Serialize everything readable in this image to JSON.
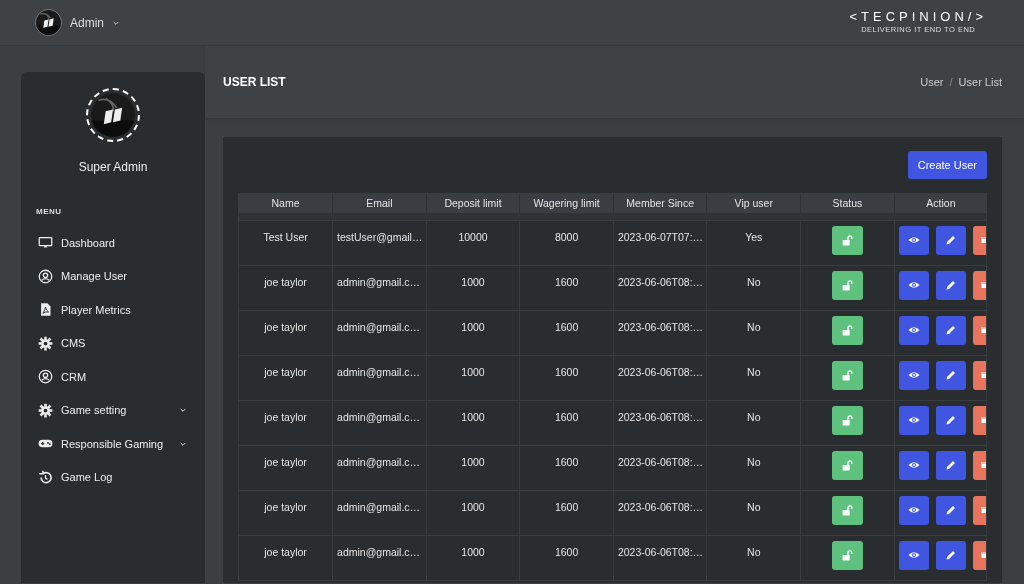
{
  "topbar": {
    "user": "Admin",
    "logo": {
      "title": "<TECPINION/>",
      "tagline": "DELIVERING IT END TO END"
    }
  },
  "sidebar": {
    "profile_name": "Super Admin",
    "menu_heading": "MENU",
    "items": [
      {
        "label": "Dashboard",
        "kind": "monitor",
        "expandable": false
      },
      {
        "label": "Manage User",
        "kind": "user",
        "expandable": false
      },
      {
        "label": "Player Metrics",
        "kind": "pdf",
        "expandable": false
      },
      {
        "label": "CMS",
        "kind": "gear",
        "expandable": false
      },
      {
        "label": "CRM",
        "kind": "user",
        "expandable": false
      },
      {
        "label": "Game setting",
        "kind": "gear",
        "expandable": true
      },
      {
        "label": "Responsible Gaming",
        "kind": "gamepad",
        "expandable": true
      },
      {
        "label": "Game Log",
        "kind": "history",
        "expandable": false
      }
    ]
  },
  "page": {
    "title": "USER LIST",
    "breadcrumb": [
      "User",
      "User List"
    ],
    "breadcrumb_separator": "/",
    "create_button": "Create User"
  },
  "table": {
    "columns": [
      "Name",
      "Email",
      "Deposit limit",
      "Wagering limit",
      "Member Since",
      "Vip user",
      "Status",
      "Action"
    ],
    "rows": [
      {
        "name": "Test User",
        "email": "testUser@gmail…",
        "deposit": "10000",
        "wagering": "8000",
        "member_since": "2023-06-07T07:…",
        "vip": "Yes",
        "locked": false
      },
      {
        "name": "joe taylor",
        "email": "admin@gmail.c…",
        "deposit": "1000",
        "wagering": "1600",
        "member_since": "2023-06-06T08:…",
        "vip": "No",
        "locked": false
      },
      {
        "name": "joe taylor",
        "email": "admin@gmail.c…",
        "deposit": "1000",
        "wagering": "1600",
        "member_since": "2023-06-06T08:…",
        "vip": "No",
        "locked": false
      },
      {
        "name": "joe taylor",
        "email": "admin@gmail.c…",
        "deposit": "1000",
        "wagering": "1600",
        "member_since": "2023-06-06T08:…",
        "vip": "No",
        "locked": false
      },
      {
        "name": "joe taylor",
        "email": "admin@gmail.c…",
        "deposit": "1000",
        "wagering": "1600",
        "member_since": "2023-06-06T08:…",
        "vip": "No",
        "locked": false
      },
      {
        "name": "joe taylor",
        "email": "admin@gmail.c…",
        "deposit": "1000",
        "wagering": "1600",
        "member_since": "2023-06-06T08:…",
        "vip": "No",
        "locked": false
      },
      {
        "name": "joe taylor",
        "email": "admin@gmail.c…",
        "deposit": "1000",
        "wagering": "1600",
        "member_since": "2023-06-06T08:…",
        "vip": "No",
        "locked": false
      },
      {
        "name": "joe taylor",
        "email": "admin@gmail.c…",
        "deposit": "1000",
        "wagering": "1600",
        "member_since": "2023-06-06T08:…",
        "vip": "No",
        "locked": false
      }
    ]
  }
}
